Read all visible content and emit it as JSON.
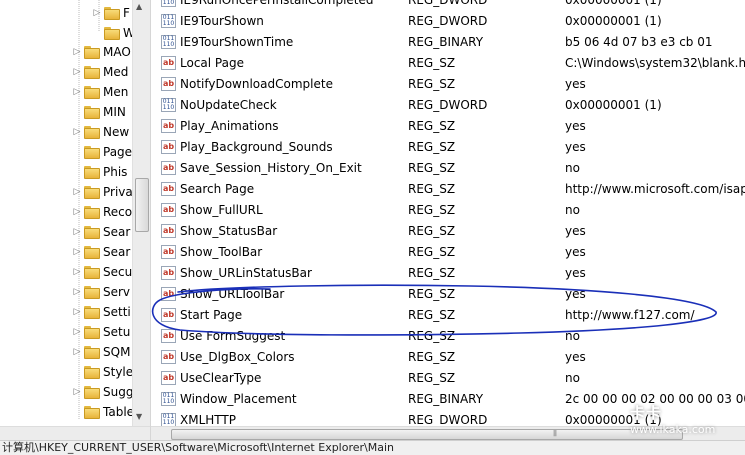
{
  "tree": {
    "items": [
      {
        "label": "F",
        "expander": "▷"
      },
      {
        "label": "W",
        "expander": ""
      },
      {
        "label": "MAO",
        "expander": "▷"
      },
      {
        "label": "Med",
        "expander": "▷"
      },
      {
        "label": "Men",
        "expander": "▷"
      },
      {
        "label": "MIN",
        "expander": ""
      },
      {
        "label": "New",
        "expander": "▷"
      },
      {
        "label": "Page",
        "expander": ""
      },
      {
        "label": "Phis",
        "expander": ""
      },
      {
        "label": "Priva",
        "expander": "▷"
      },
      {
        "label": "Reco",
        "expander": "▷"
      },
      {
        "label": "Sear",
        "expander": "▷"
      },
      {
        "label": "Sear",
        "expander": "▷"
      },
      {
        "label": "Secu",
        "expander": "▷"
      },
      {
        "label": "Serv",
        "expander": "▷"
      },
      {
        "label": "Setti",
        "expander": "▷"
      },
      {
        "label": "Setu",
        "expander": "▷"
      },
      {
        "label": "SQM",
        "expander": "▷"
      },
      {
        "label": "Style",
        "expander": ""
      },
      {
        "label": "Sugg",
        "expander": "▷"
      },
      {
        "label": "Table",
        "expander": ""
      }
    ]
  },
  "values": [
    {
      "name": "IE9RunOncePerInstallCompleted",
      "type": "REG_DWORD",
      "data": "0x00000001 (1)",
      "kind": "dword"
    },
    {
      "name": "IE9TourShown",
      "type": "REG_DWORD",
      "data": "0x00000001 (1)",
      "kind": "dword"
    },
    {
      "name": "IE9TourShownTime",
      "type": "REG_BINARY",
      "data": "b5 06 4d 07 b3 e3 cb 01",
      "kind": "dword"
    },
    {
      "name": "Local Page",
      "type": "REG_SZ",
      "data": "C:\\Windows\\system32\\blank.htm",
      "kind": "sz"
    },
    {
      "name": "NotifyDownloadComplete",
      "type": "REG_SZ",
      "data": "yes",
      "kind": "sz"
    },
    {
      "name": "NoUpdateCheck",
      "type": "REG_DWORD",
      "data": "0x00000001 (1)",
      "kind": "dword"
    },
    {
      "name": "Play_Animations",
      "type": "REG_SZ",
      "data": "yes",
      "kind": "sz"
    },
    {
      "name": "Play_Background_Sounds",
      "type": "REG_SZ",
      "data": "yes",
      "kind": "sz"
    },
    {
      "name": "Save_Session_History_On_Exit",
      "type": "REG_SZ",
      "data": "no",
      "kind": "sz"
    },
    {
      "name": "Search Page",
      "type": "REG_SZ",
      "data": "http://www.microsoft.com/isapi/redir",
      "kind": "sz"
    },
    {
      "name": "Show_FullURL",
      "type": "REG_SZ",
      "data": "no",
      "kind": "sz"
    },
    {
      "name": "Show_StatusBar",
      "type": "REG_SZ",
      "data": "yes",
      "kind": "sz"
    },
    {
      "name": "Show_ToolBar",
      "type": "REG_SZ",
      "data": "yes",
      "kind": "sz"
    },
    {
      "name": "Show_URLinStatusBar",
      "type": "REG_SZ",
      "data": "yes",
      "kind": "sz"
    },
    {
      "name": "Show_URLToolBar",
      "type": "REG_SZ",
      "data": "yes",
      "kind": "sz"
    },
    {
      "name": "Start Page",
      "type": "REG_SZ",
      "data": "http://www.f127.com/",
      "kind": "sz"
    },
    {
      "name": "Use FormSuggest",
      "type": "REG_SZ",
      "data": "no",
      "kind": "sz"
    },
    {
      "name": "Use_DlgBox_Colors",
      "type": "REG_SZ",
      "data": "yes",
      "kind": "sz"
    },
    {
      "name": "UseClearType",
      "type": "REG_SZ",
      "data": "no",
      "kind": "sz"
    },
    {
      "name": "Window_Placement",
      "type": "REG_BINARY",
      "data": "2c 00 00 00 02 00 00 00 03 00",
      "kind": "dword"
    },
    {
      "name": "XMLHTTP",
      "type": "REG_DWORD",
      "data": "0x00000001 (1)",
      "kind": "dword"
    }
  ],
  "status_bar": {
    "path": "计算机\\HKEY_CURRENT_USER\\Software\\Microsoft\\Internet Explorer\\Main"
  },
  "watermark": {
    "line1": "卡卡",
    "line2": "www.ikaka.com"
  },
  "colors": {
    "annotation": "#1a2fb8"
  }
}
